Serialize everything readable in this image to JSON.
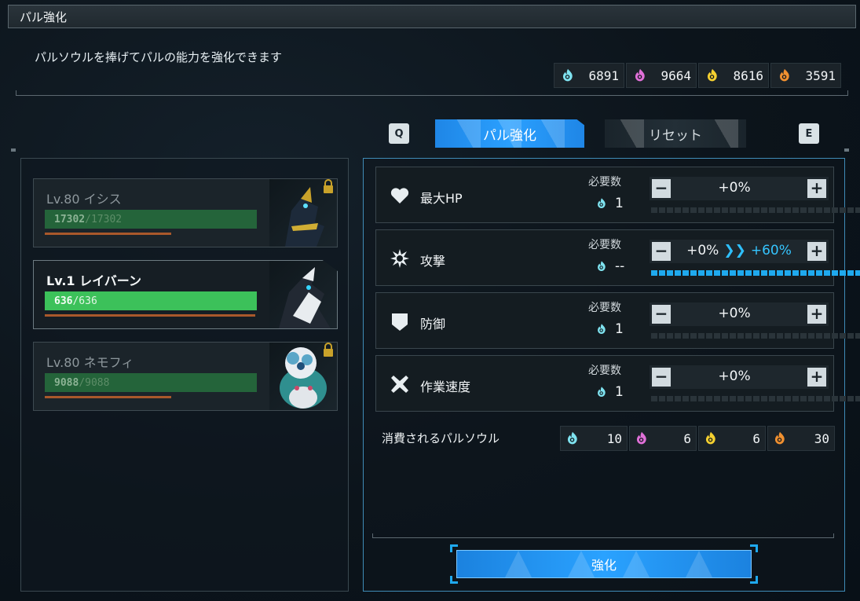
{
  "title": "パル強化",
  "subtitle": "パルソウルを捧げてパルの能力を強化できます",
  "colors": {
    "accent": "#2aa0ff",
    "hp_bar": "#3cc15a",
    "soul_cyan": "#7fe3f0",
    "soul_pink": "#e070d8",
    "soul_yellow": "#f5d030",
    "soul_orange": "#f09030"
  },
  "currencies": [
    {
      "icon": "small-pal-soul-icon",
      "color": "#7fe3f0",
      "value": "6891"
    },
    {
      "icon": "medium-pal-soul-icon",
      "color": "#e070d8",
      "value": "9664"
    },
    {
      "icon": "large-pal-soul-icon",
      "color": "#f5d030",
      "value": "8616"
    },
    {
      "icon": "giant-pal-soul-icon",
      "color": "#f09030",
      "value": "3591"
    }
  ],
  "tabs": {
    "prev_key": "Q",
    "next_key": "E",
    "enhance": "パル強化",
    "reset": "リセット"
  },
  "pals": [
    {
      "name": "Lv.80 イシス",
      "hp": "17302",
      "hp_max": "/17302",
      "locked": true,
      "selected": false,
      "stamina": 0.6
    },
    {
      "name": "Lv.1 レイバーン",
      "hp": "636",
      "hp_max": "/636",
      "locked": false,
      "selected": true,
      "stamina": 1.0
    },
    {
      "name": "Lv.80 ネモフィ",
      "hp": "9088",
      "hp_max": "/9088",
      "locked": true,
      "selected": false,
      "stamina": 0.6
    }
  ],
  "stats": [
    {
      "label": "最大HP",
      "icon": "heart-icon",
      "req_label": "必要数",
      "req_value": "1",
      "current": "+0%",
      "arrow": "",
      "new": "",
      "level": 0
    },
    {
      "label": "攻撃",
      "icon": "attack-burst-icon",
      "req_label": "必要数",
      "req_value": "--",
      "current": "+0%",
      "arrow": "❯❯",
      "new": "+60%",
      "level": 1.0
    },
    {
      "label": "防御",
      "icon": "shield-icon",
      "req_label": "必要数",
      "req_value": "1",
      "current": "+0%",
      "arrow": "",
      "new": "",
      "level": 0
    },
    {
      "label": "作業速度",
      "icon": "work-speed-icon",
      "req_label": "必要数",
      "req_value": "1",
      "current": "+0%",
      "arrow": "",
      "new": "",
      "level": 0
    }
  ],
  "consumption": {
    "label": "消費されるパルソウル",
    "values": [
      "10",
      "6",
      "6",
      "30"
    ]
  },
  "confirm_button": "強化"
}
